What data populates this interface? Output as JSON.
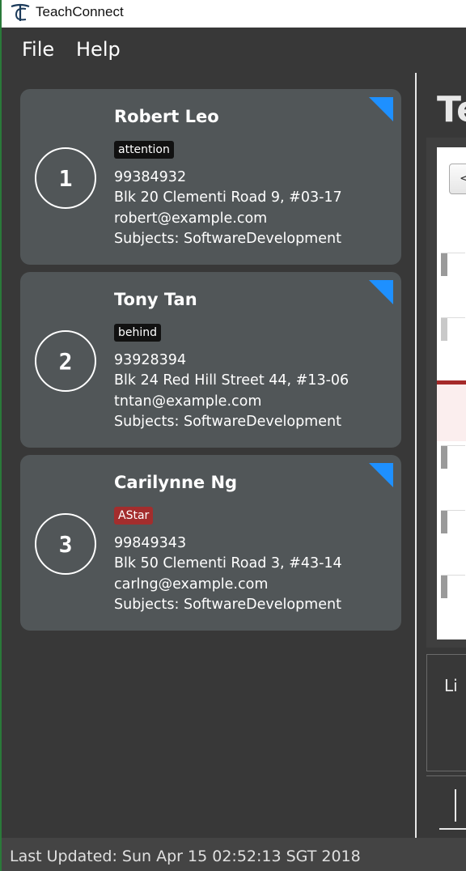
{
  "window": {
    "title": "TeachConnect",
    "logo_icon": "teachconnect-logo-icon"
  },
  "menu": {
    "file": "File",
    "help": "Help"
  },
  "students": [
    {
      "index": "1",
      "name": "Robert Leo",
      "tag": "attention",
      "tag_color": "#111111",
      "phone": "99384932",
      "address": "Blk 20 Clementi Road 9, #03-17",
      "email": "robert@example.com",
      "subjects": "Subjects: SoftwareDevelopment"
    },
    {
      "index": "2",
      "name": "Tony Tan",
      "tag": "behind",
      "tag_color": "#111111",
      "phone": "93928394",
      "address": "Blk 24 Red Hill Street 44, #13-06",
      "email": "tntan@example.com",
      "subjects": "Subjects: SoftwareDevelopment"
    },
    {
      "index": "3",
      "name": "Carilynne Ng",
      "tag": "AStar",
      "tag_color": "#a32d2d",
      "phone": "99849343",
      "address": "Blk 50 Clementi Road 3, #43-14",
      "email": "carlng@example.com",
      "subjects": "Subjects: SoftwareDevelopment"
    }
  ],
  "right_panel": {
    "title": "Te",
    "calendar_nav": "<",
    "log_text": "Li"
  },
  "status": {
    "last_updated": "Last Updated: Sun Apr 15 02:52:13 SGT 2018"
  },
  "colors": {
    "background": "#383838",
    "card": "#515658",
    "corner_accent": "#1e90ff"
  }
}
